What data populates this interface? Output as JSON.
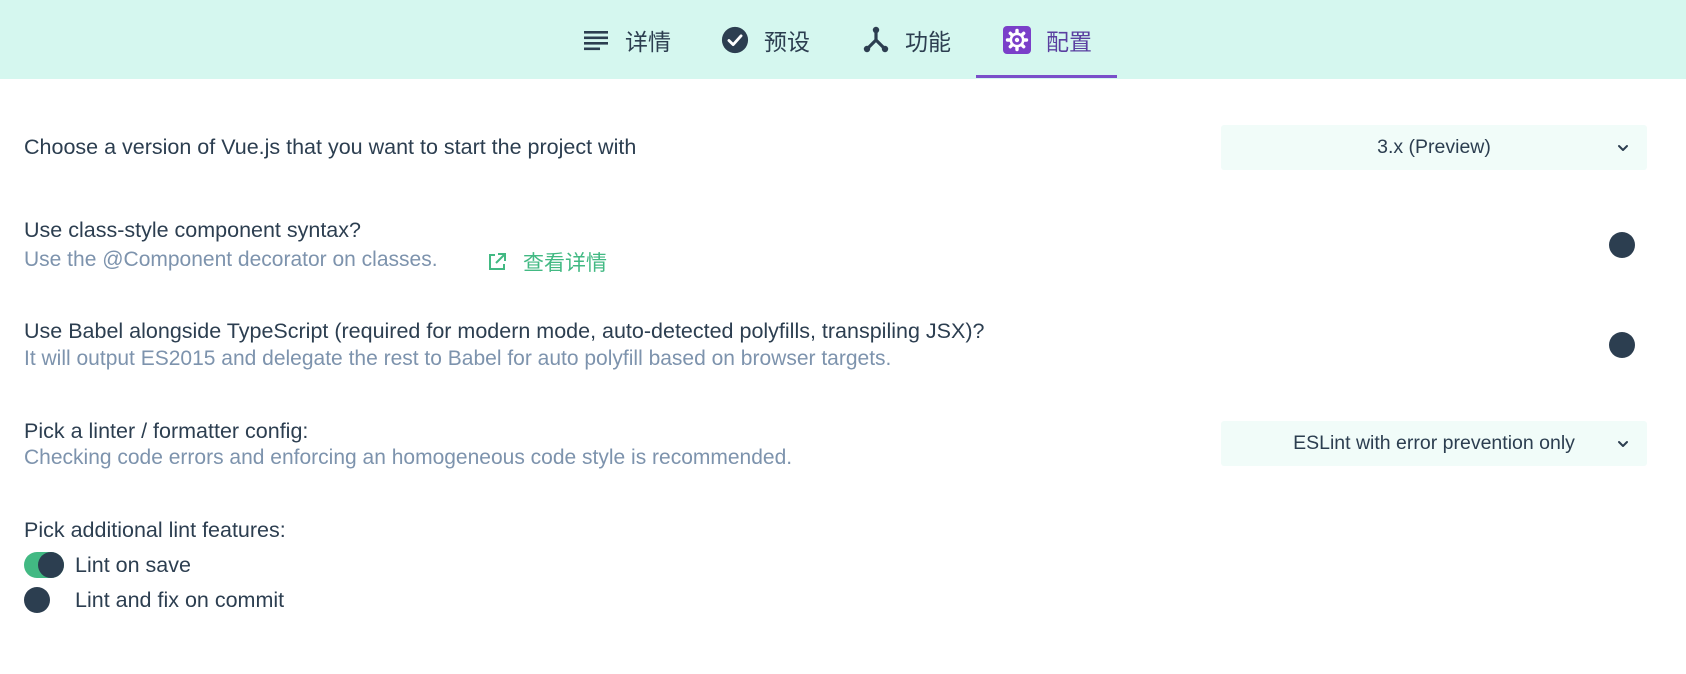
{
  "tabs": [
    {
      "label": "详情",
      "icon": "list-icon",
      "active": false
    },
    {
      "label": "预设",
      "icon": "check-circle-icon",
      "active": false
    },
    {
      "label": "功能",
      "icon": "features-icon",
      "active": false
    },
    {
      "label": "配置",
      "icon": "gear-icon",
      "active": true
    }
  ],
  "colors": {
    "tabbar_bg": "#d5f7ef",
    "accent": "#42b983",
    "active_tab": "#7a4fc9",
    "text": "#2c3e50",
    "muted": "#7d93ad"
  },
  "config": {
    "vue_version": {
      "label": "Choose a version of Vue.js that you want to start the project with",
      "value": "3.x (Preview)"
    },
    "class_component": {
      "label": "Use class-style component syntax?",
      "description": "Use the @Component decorator on classes.",
      "link": "查看详情",
      "enabled": false
    },
    "babel": {
      "label": "Use Babel alongside TypeScript (required for modern mode, auto-detected polyfills, transpiling JSX)?",
      "description": "It will output ES2015 and delegate the rest to Babel for auto polyfill based on browser targets.",
      "enabled": false
    },
    "linter": {
      "label": "Pick a linter / formatter config:",
      "description": "Checking code errors and enforcing an homogeneous code style is recommended.",
      "value": "ESLint with error prevention only"
    },
    "lint_features": {
      "label": "Pick additional lint features:",
      "options": [
        {
          "label": "Lint on save",
          "checked": true
        },
        {
          "label": "Lint and fix on commit",
          "checked": false
        }
      ]
    }
  }
}
